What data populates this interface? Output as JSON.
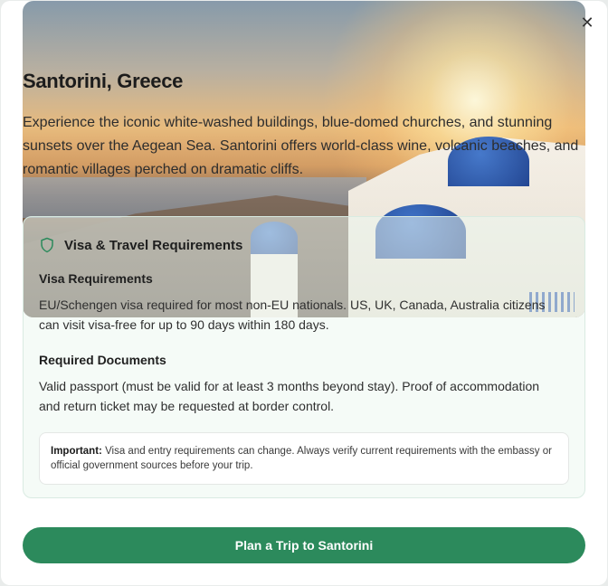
{
  "modal": {
    "close_icon": "close-icon",
    "title": "Santorini, Greece",
    "description": "Experience the iconic white-washed buildings, blue-domed churches, and stunning sunsets over the Aegean Sea. Santorini offers world-class wine, volcanic beaches, and romantic villages perched on dramatic cliffs."
  },
  "requirements": {
    "icon": "shield-icon",
    "title": "Visa & Travel Requirements",
    "visa_heading": "Visa Requirements",
    "visa_text": "EU/Schengen visa required for most non-EU nationals. US, UK, Canada, Australia citizens can visit visa-free for up to 90 days within 180 days.",
    "docs_heading": "Required Documents",
    "docs_text": "Valid passport (must be valid for at least 3 months beyond stay). Proof of accommodation and return ticket may be requested at border control.",
    "note_label": "Important:",
    "note_text": "Visa and entry requirements can change. Always verify current requirements with the embassy or official government sources before your trip."
  },
  "cta": {
    "label": "Plan a Trip to Santorini"
  },
  "colors": {
    "accent": "#2c8a5c",
    "panel_border": "#d9ebe2"
  }
}
